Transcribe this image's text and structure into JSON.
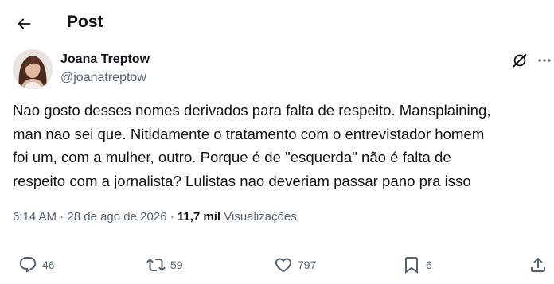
{
  "header": {
    "title": "Post",
    "back_icon": "arrow-left-icon"
  },
  "author": {
    "name": "Joana Treptow",
    "handle": "@joanatreptow",
    "avatar": "avatar-photo"
  },
  "tweet": {
    "lines": [
      "Nao gosto desses nomes derivados para falta de respeito. Mansplaining,",
      "man nao sei que. Nitidamente o tratamento com o entrevistador homem",
      "foi um, com a mulher, outro. Porque é de \"esquerda\" não é falta de",
      "respeito com a jornalista? Lulistas nao deveriam passar pano pra isso"
    ]
  },
  "meta": {
    "time": "6:14 AM",
    "separator": "·",
    "date": "28 de ago de 2026",
    "views_count": "11,7 mil",
    "views_label": "Visualizações"
  },
  "actions": {
    "replies": "46",
    "reposts": "59",
    "likes": "797",
    "bookmarks": "6"
  },
  "colors": {
    "text": "#0f1419",
    "secondary": "#536471",
    "background": "#ffffff"
  }
}
